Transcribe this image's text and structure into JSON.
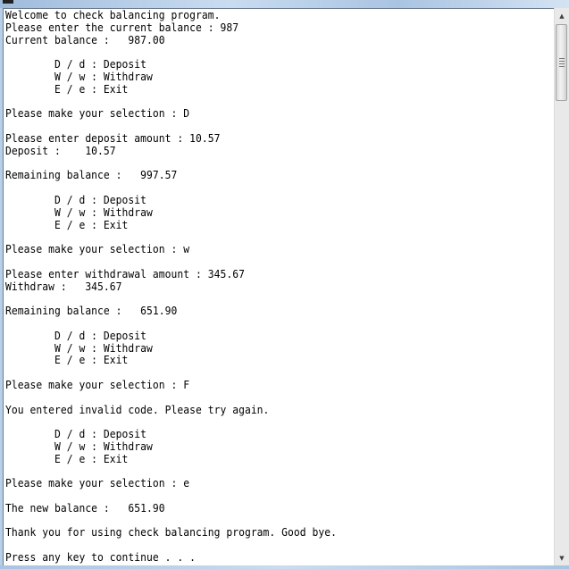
{
  "window": {
    "type": "console",
    "theme_colors": {
      "frame": "#b9d1ea",
      "console_background": "#ffffff",
      "console_text": "#000000"
    }
  },
  "console": {
    "lines": [
      "Welcome to check balancing program.",
      "Please enter the current balance : 987",
      "Current balance :   987.00",
      "",
      "        D / d : Deposit",
      "        W / w : Withdraw",
      "        E / e : Exit",
      "",
      "Please make your selection : D",
      "",
      "Please enter deposit amount : 10.57",
      "Deposit :    10.57",
      "",
      "Remaining balance :   997.57",
      "",
      "        D / d : Deposit",
      "        W / w : Withdraw",
      "        E / e : Exit",
      "",
      "Please make your selection : w",
      "",
      "Please enter withdrawal amount : 345.67",
      "Withdraw :   345.67",
      "",
      "Remaining balance :   651.90",
      "",
      "        D / d : Deposit",
      "        W / w : Withdraw",
      "        E / e : Exit",
      "",
      "Please make your selection : F",
      "",
      "You entered invalid code. Please try again.",
      "",
      "        D / d : Deposit",
      "        W / w : Withdraw",
      "        E / e : Exit",
      "",
      "Please make your selection : e",
      "",
      "The new balance :   651.90",
      "",
      "Thank you for using check balancing program. Good bye.",
      "",
      "Press any key to continue . . ."
    ]
  },
  "scrollbar": {
    "up_icon": "arrow-up-icon",
    "down_icon": "arrow-down-icon",
    "up_glyph": "▲",
    "down_glyph": "▼",
    "thumb_position_fraction": 0.0
  }
}
